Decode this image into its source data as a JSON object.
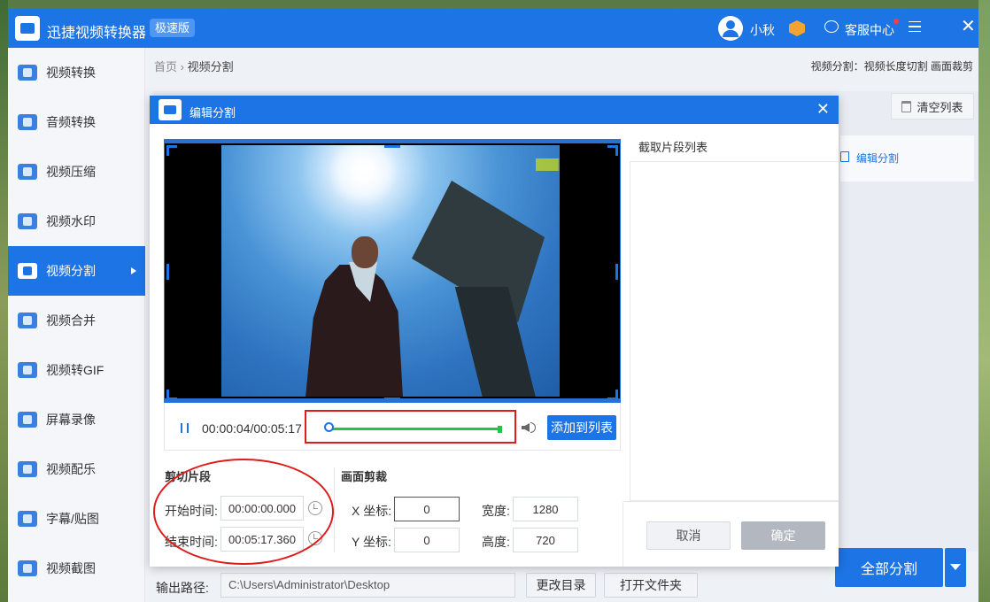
{
  "app": {
    "title": "迅捷视频转换器",
    "badge": "极速版",
    "user_name": "小秋",
    "service_label": "客服中心"
  },
  "sidebar": {
    "items": [
      {
        "label": "视频转换"
      },
      {
        "label": "音频转换"
      },
      {
        "label": "视频压缩"
      },
      {
        "label": "视频水印"
      },
      {
        "label": "视频分割"
      },
      {
        "label": "视频合并"
      },
      {
        "label": "视频转GIF"
      },
      {
        "label": "屏幕录像"
      },
      {
        "label": "视频配乐"
      },
      {
        "label": "字幕/贴图"
      },
      {
        "label": "视频截图"
      }
    ],
    "active_index": 4
  },
  "header": {
    "breadcrumb_home": "首页",
    "breadcrumb_sep": "›",
    "breadcrumb_current": "视频分割",
    "right_text": "视频分割：视频长度切割 画面裁剪"
  },
  "list": {
    "clear_label": "清空列表",
    "edit_split_link": "编辑分割"
  },
  "footer": {
    "output_label": "输出路径:",
    "output_path": "C:\\Users\\Administrator\\Desktop",
    "change_dir_label": "更改目录",
    "open_folder_label": "打开文件夹",
    "split_all_label": "全部分割"
  },
  "modal": {
    "title": "编辑分割",
    "close": "✕",
    "player": {
      "time": "00:00:04/00:05:17",
      "add_to_list_label": "添加到列表"
    },
    "cut_segment": {
      "title": "剪切片段",
      "start_label": "开始时间:",
      "start_value": "00:00:00.000",
      "end_label": "结束时间:",
      "end_value": "00:05:17.360"
    },
    "crop": {
      "title": "画面剪裁",
      "x_label": "X 坐标:",
      "x_value": "0",
      "y_label": "Y 坐标:",
      "y_value": "0",
      "width_label": "宽度:",
      "width_value": "1280",
      "height_label": "高度:",
      "height_value": "720"
    },
    "segment_list_title": "截取片段列表",
    "cancel_label": "取消",
    "confirm_label": "确定"
  },
  "colors": {
    "primary": "#1d74e4",
    "annotation_red": "#e01b1b",
    "trim_green": "#26c24a"
  }
}
